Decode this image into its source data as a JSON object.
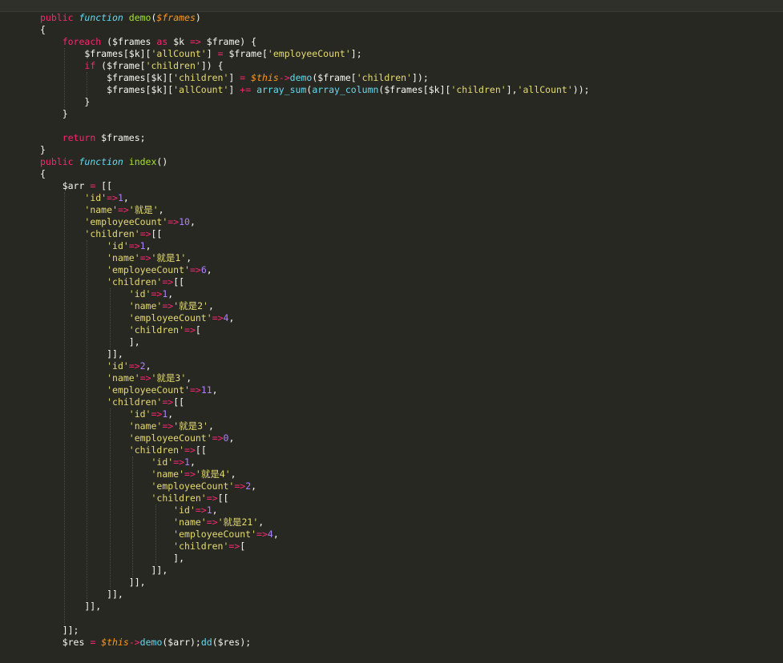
{
  "editor": {
    "language": "php",
    "theme": "monokai",
    "colors": {
      "background": "#272822",
      "text": "#f8f8f2",
      "keyword": "#f92672",
      "storage": "#66d9ef",
      "function_name": "#a6e22e",
      "variable_parameter": "#fd971f",
      "string": "#e6db74",
      "number": "#ae81ff"
    },
    "lines": [
      [
        {
          "t": "public ",
          "c": "kw"
        },
        {
          "t": "function ",
          "c": "st"
        },
        {
          "t": "demo",
          "c": "fn"
        },
        {
          "t": "(",
          "c": "plain"
        },
        {
          "t": "$frames",
          "c": "var"
        },
        {
          "t": ")",
          "c": "plain"
        }
      ],
      [
        {
          "t": "{",
          "c": "plain"
        }
      ],
      [
        {
          "t": "    ",
          "c": "plain"
        },
        {
          "t": "foreach",
          "c": "kw"
        },
        {
          "t": " ($frames ",
          "c": "plain"
        },
        {
          "t": "as",
          "c": "kw"
        },
        {
          "t": " $k ",
          "c": "plain"
        },
        {
          "t": "=>",
          "c": "kw"
        },
        {
          "t": " $frame) {",
          "c": "plain"
        }
      ],
      [
        {
          "t": "        $frames[$k][",
          "c": "plain"
        },
        {
          "t": "'allCount'",
          "c": "str"
        },
        {
          "t": "] ",
          "c": "plain"
        },
        {
          "t": "=",
          "c": "kw"
        },
        {
          "t": " $frame[",
          "c": "plain"
        },
        {
          "t": "'employeeCount'",
          "c": "str"
        },
        {
          "t": "];",
          "c": "plain"
        }
      ],
      [
        {
          "t": "        ",
          "c": "plain"
        },
        {
          "t": "if",
          "c": "kw"
        },
        {
          "t": " ($frame[",
          "c": "plain"
        },
        {
          "t": "'children'",
          "c": "str"
        },
        {
          "t": "]) {",
          "c": "plain"
        }
      ],
      [
        {
          "t": "            $frames[$k][",
          "c": "plain"
        },
        {
          "t": "'children'",
          "c": "str"
        },
        {
          "t": "] ",
          "c": "plain"
        },
        {
          "t": "=",
          "c": "kw"
        },
        {
          "t": " ",
          "c": "plain"
        },
        {
          "t": "$this",
          "c": "var"
        },
        {
          "t": "->",
          "c": "kw"
        },
        {
          "t": "demo",
          "c": "call"
        },
        {
          "t": "($frame[",
          "c": "plain"
        },
        {
          "t": "'children'",
          "c": "str"
        },
        {
          "t": "]);",
          "c": "plain"
        }
      ],
      [
        {
          "t": "            $frames[$k][",
          "c": "plain"
        },
        {
          "t": "'allCount'",
          "c": "str"
        },
        {
          "t": "] ",
          "c": "plain"
        },
        {
          "t": "+=",
          "c": "kw"
        },
        {
          "t": " ",
          "c": "plain"
        },
        {
          "t": "array_sum",
          "c": "call"
        },
        {
          "t": "(",
          "c": "plain"
        },
        {
          "t": "array_column",
          "c": "call"
        },
        {
          "t": "($frames[$k][",
          "c": "plain"
        },
        {
          "t": "'children'",
          "c": "str"
        },
        {
          "t": "],",
          "c": "plain"
        },
        {
          "t": "'allCount'",
          "c": "str"
        },
        {
          "t": "));",
          "c": "plain"
        }
      ],
      [
        {
          "t": "        }",
          "c": "plain"
        }
      ],
      [
        {
          "t": "    }",
          "c": "plain"
        }
      ],
      [],
      [
        {
          "t": "    ",
          "c": "plain"
        },
        {
          "t": "return",
          "c": "kw"
        },
        {
          "t": " $frames;",
          "c": "plain"
        }
      ],
      [
        {
          "t": "}",
          "c": "plain"
        }
      ],
      [
        {
          "t": "public ",
          "c": "kw"
        },
        {
          "t": "function ",
          "c": "st"
        },
        {
          "t": "index",
          "c": "fn"
        },
        {
          "t": "()",
          "c": "plain"
        }
      ],
      [
        {
          "t": "{",
          "c": "plain"
        }
      ],
      [
        {
          "t": "    $arr ",
          "c": "plain"
        },
        {
          "t": "=",
          "c": "kw"
        },
        {
          "t": " [[",
          "c": "plain"
        }
      ],
      [
        {
          "t": "        ",
          "c": "plain"
        },
        {
          "t": "'id'",
          "c": "str"
        },
        {
          "t": "=>",
          "c": "kw"
        },
        {
          "t": "1",
          "c": "num"
        },
        {
          "t": ",",
          "c": "plain"
        }
      ],
      [
        {
          "t": "        ",
          "c": "plain"
        },
        {
          "t": "'name'",
          "c": "str"
        },
        {
          "t": "=>",
          "c": "kw"
        },
        {
          "t": "'就是'",
          "c": "str"
        },
        {
          "t": ",",
          "c": "plain"
        }
      ],
      [
        {
          "t": "        ",
          "c": "plain"
        },
        {
          "t": "'employeeCount'",
          "c": "str"
        },
        {
          "t": "=>",
          "c": "kw"
        },
        {
          "t": "10",
          "c": "num"
        },
        {
          "t": ",",
          "c": "plain"
        }
      ],
      [
        {
          "t": "        ",
          "c": "plain"
        },
        {
          "t": "'children'",
          "c": "str"
        },
        {
          "t": "=>",
          "c": "kw"
        },
        {
          "t": "[[",
          "c": "plain"
        }
      ],
      [
        {
          "t": "            ",
          "c": "plain"
        },
        {
          "t": "'id'",
          "c": "str"
        },
        {
          "t": "=>",
          "c": "kw"
        },
        {
          "t": "1",
          "c": "num"
        },
        {
          "t": ",",
          "c": "plain"
        }
      ],
      [
        {
          "t": "            ",
          "c": "plain"
        },
        {
          "t": "'name'",
          "c": "str"
        },
        {
          "t": "=>",
          "c": "kw"
        },
        {
          "t": "'就是1'",
          "c": "str"
        },
        {
          "t": ",",
          "c": "plain"
        }
      ],
      [
        {
          "t": "            ",
          "c": "plain"
        },
        {
          "t": "'employeeCount'",
          "c": "str"
        },
        {
          "t": "=>",
          "c": "kw"
        },
        {
          "t": "6",
          "c": "num"
        },
        {
          "t": ",",
          "c": "plain"
        }
      ],
      [
        {
          "t": "            ",
          "c": "plain"
        },
        {
          "t": "'children'",
          "c": "str"
        },
        {
          "t": "=>",
          "c": "kw"
        },
        {
          "t": "[[",
          "c": "plain"
        }
      ],
      [
        {
          "t": "                ",
          "c": "plain"
        },
        {
          "t": "'id'",
          "c": "str"
        },
        {
          "t": "=>",
          "c": "kw"
        },
        {
          "t": "1",
          "c": "num"
        },
        {
          "t": ",",
          "c": "plain"
        }
      ],
      [
        {
          "t": "                ",
          "c": "plain"
        },
        {
          "t": "'name'",
          "c": "str"
        },
        {
          "t": "=>",
          "c": "kw"
        },
        {
          "t": "'就是2'",
          "c": "str"
        },
        {
          "t": ",",
          "c": "plain"
        }
      ],
      [
        {
          "t": "                ",
          "c": "plain"
        },
        {
          "t": "'employeeCount'",
          "c": "str"
        },
        {
          "t": "=>",
          "c": "kw"
        },
        {
          "t": "4",
          "c": "num"
        },
        {
          "t": ",",
          "c": "plain"
        }
      ],
      [
        {
          "t": "                ",
          "c": "plain"
        },
        {
          "t": "'children'",
          "c": "str"
        },
        {
          "t": "=>",
          "c": "kw"
        },
        {
          "t": "[",
          "c": "plain"
        }
      ],
      [
        {
          "t": "                ],",
          "c": "plain"
        }
      ],
      [
        {
          "t": "            ]],",
          "c": "plain"
        }
      ],
      [
        {
          "t": "            ",
          "c": "plain"
        },
        {
          "t": "'id'",
          "c": "str"
        },
        {
          "t": "=>",
          "c": "kw"
        },
        {
          "t": "2",
          "c": "num"
        },
        {
          "t": ",",
          "c": "plain"
        }
      ],
      [
        {
          "t": "            ",
          "c": "plain"
        },
        {
          "t": "'name'",
          "c": "str"
        },
        {
          "t": "=>",
          "c": "kw"
        },
        {
          "t": "'就是3'",
          "c": "str"
        },
        {
          "t": ",",
          "c": "plain"
        }
      ],
      [
        {
          "t": "            ",
          "c": "plain"
        },
        {
          "t": "'employeeCount'",
          "c": "str"
        },
        {
          "t": "=>",
          "c": "kw"
        },
        {
          "t": "11",
          "c": "num"
        },
        {
          "t": ",",
          "c": "plain"
        }
      ],
      [
        {
          "t": "            ",
          "c": "plain"
        },
        {
          "t": "'children'",
          "c": "str"
        },
        {
          "t": "=>",
          "c": "kw"
        },
        {
          "t": "[[",
          "c": "plain"
        }
      ],
      [
        {
          "t": "                ",
          "c": "plain"
        },
        {
          "t": "'id'",
          "c": "str"
        },
        {
          "t": "=>",
          "c": "kw"
        },
        {
          "t": "1",
          "c": "num"
        },
        {
          "t": ",",
          "c": "plain"
        }
      ],
      [
        {
          "t": "                ",
          "c": "plain"
        },
        {
          "t": "'name'",
          "c": "str"
        },
        {
          "t": "=>",
          "c": "kw"
        },
        {
          "t": "'就是3'",
          "c": "str"
        },
        {
          "t": ",",
          "c": "plain"
        }
      ],
      [
        {
          "t": "                ",
          "c": "plain"
        },
        {
          "t": "'employeeCount'",
          "c": "str"
        },
        {
          "t": "=>",
          "c": "kw"
        },
        {
          "t": "0",
          "c": "num"
        },
        {
          "t": ",",
          "c": "plain"
        }
      ],
      [
        {
          "t": "                ",
          "c": "plain"
        },
        {
          "t": "'children'",
          "c": "str"
        },
        {
          "t": "=>",
          "c": "kw"
        },
        {
          "t": "[[",
          "c": "plain"
        }
      ],
      [
        {
          "t": "                    ",
          "c": "plain"
        },
        {
          "t": "'id'",
          "c": "str"
        },
        {
          "t": "=>",
          "c": "kw"
        },
        {
          "t": "1",
          "c": "num"
        },
        {
          "t": ",",
          "c": "plain"
        }
      ],
      [
        {
          "t": "                    ",
          "c": "plain"
        },
        {
          "t": "'name'",
          "c": "str"
        },
        {
          "t": "=>",
          "c": "kw"
        },
        {
          "t": "'就是4'",
          "c": "str"
        },
        {
          "t": ",",
          "c": "plain"
        }
      ],
      [
        {
          "t": "                    ",
          "c": "plain"
        },
        {
          "t": "'employeeCount'",
          "c": "str"
        },
        {
          "t": "=>",
          "c": "kw"
        },
        {
          "t": "2",
          "c": "num"
        },
        {
          "t": ",",
          "c": "plain"
        }
      ],
      [
        {
          "t": "                    ",
          "c": "plain"
        },
        {
          "t": "'children'",
          "c": "str"
        },
        {
          "t": "=>",
          "c": "kw"
        },
        {
          "t": "[[",
          "c": "plain"
        }
      ],
      [
        {
          "t": "                        ",
          "c": "plain"
        },
        {
          "t": "'id'",
          "c": "str"
        },
        {
          "t": "=>",
          "c": "kw"
        },
        {
          "t": "1",
          "c": "num"
        },
        {
          "t": ",",
          "c": "plain"
        }
      ],
      [
        {
          "t": "                        ",
          "c": "plain"
        },
        {
          "t": "'name'",
          "c": "str"
        },
        {
          "t": "=>",
          "c": "kw"
        },
        {
          "t": "'就是21'",
          "c": "str"
        },
        {
          "t": ",",
          "c": "plain"
        }
      ],
      [
        {
          "t": "                        ",
          "c": "plain"
        },
        {
          "t": "'employeeCount'",
          "c": "str"
        },
        {
          "t": "=>",
          "c": "kw"
        },
        {
          "t": "4",
          "c": "num"
        },
        {
          "t": ",",
          "c": "plain"
        }
      ],
      [
        {
          "t": "                        ",
          "c": "plain"
        },
        {
          "t": "'children'",
          "c": "str"
        },
        {
          "t": "=>",
          "c": "kw"
        },
        {
          "t": "[",
          "c": "plain"
        }
      ],
      [
        {
          "t": "                        ],",
          "c": "plain"
        }
      ],
      [
        {
          "t": "                    ]],",
          "c": "plain"
        }
      ],
      [
        {
          "t": "                ]],",
          "c": "plain"
        }
      ],
      [
        {
          "t": "            ]],",
          "c": "plain"
        }
      ],
      [
        {
          "t": "        ]],",
          "c": "plain"
        }
      ],
      [],
      [
        {
          "t": "    ]];",
          "c": "plain"
        }
      ],
      [
        {
          "t": "    $res ",
          "c": "plain"
        },
        {
          "t": "=",
          "c": "kw"
        },
        {
          "t": " ",
          "c": "plain"
        },
        {
          "t": "$this",
          "c": "var"
        },
        {
          "t": "->",
          "c": "kw"
        },
        {
          "t": "demo",
          "c": "call"
        },
        {
          "t": "($arr);",
          "c": "plain"
        },
        {
          "t": "dd",
          "c": "call"
        },
        {
          "t": "($res);",
          "c": "plain"
        }
      ]
    ]
  }
}
